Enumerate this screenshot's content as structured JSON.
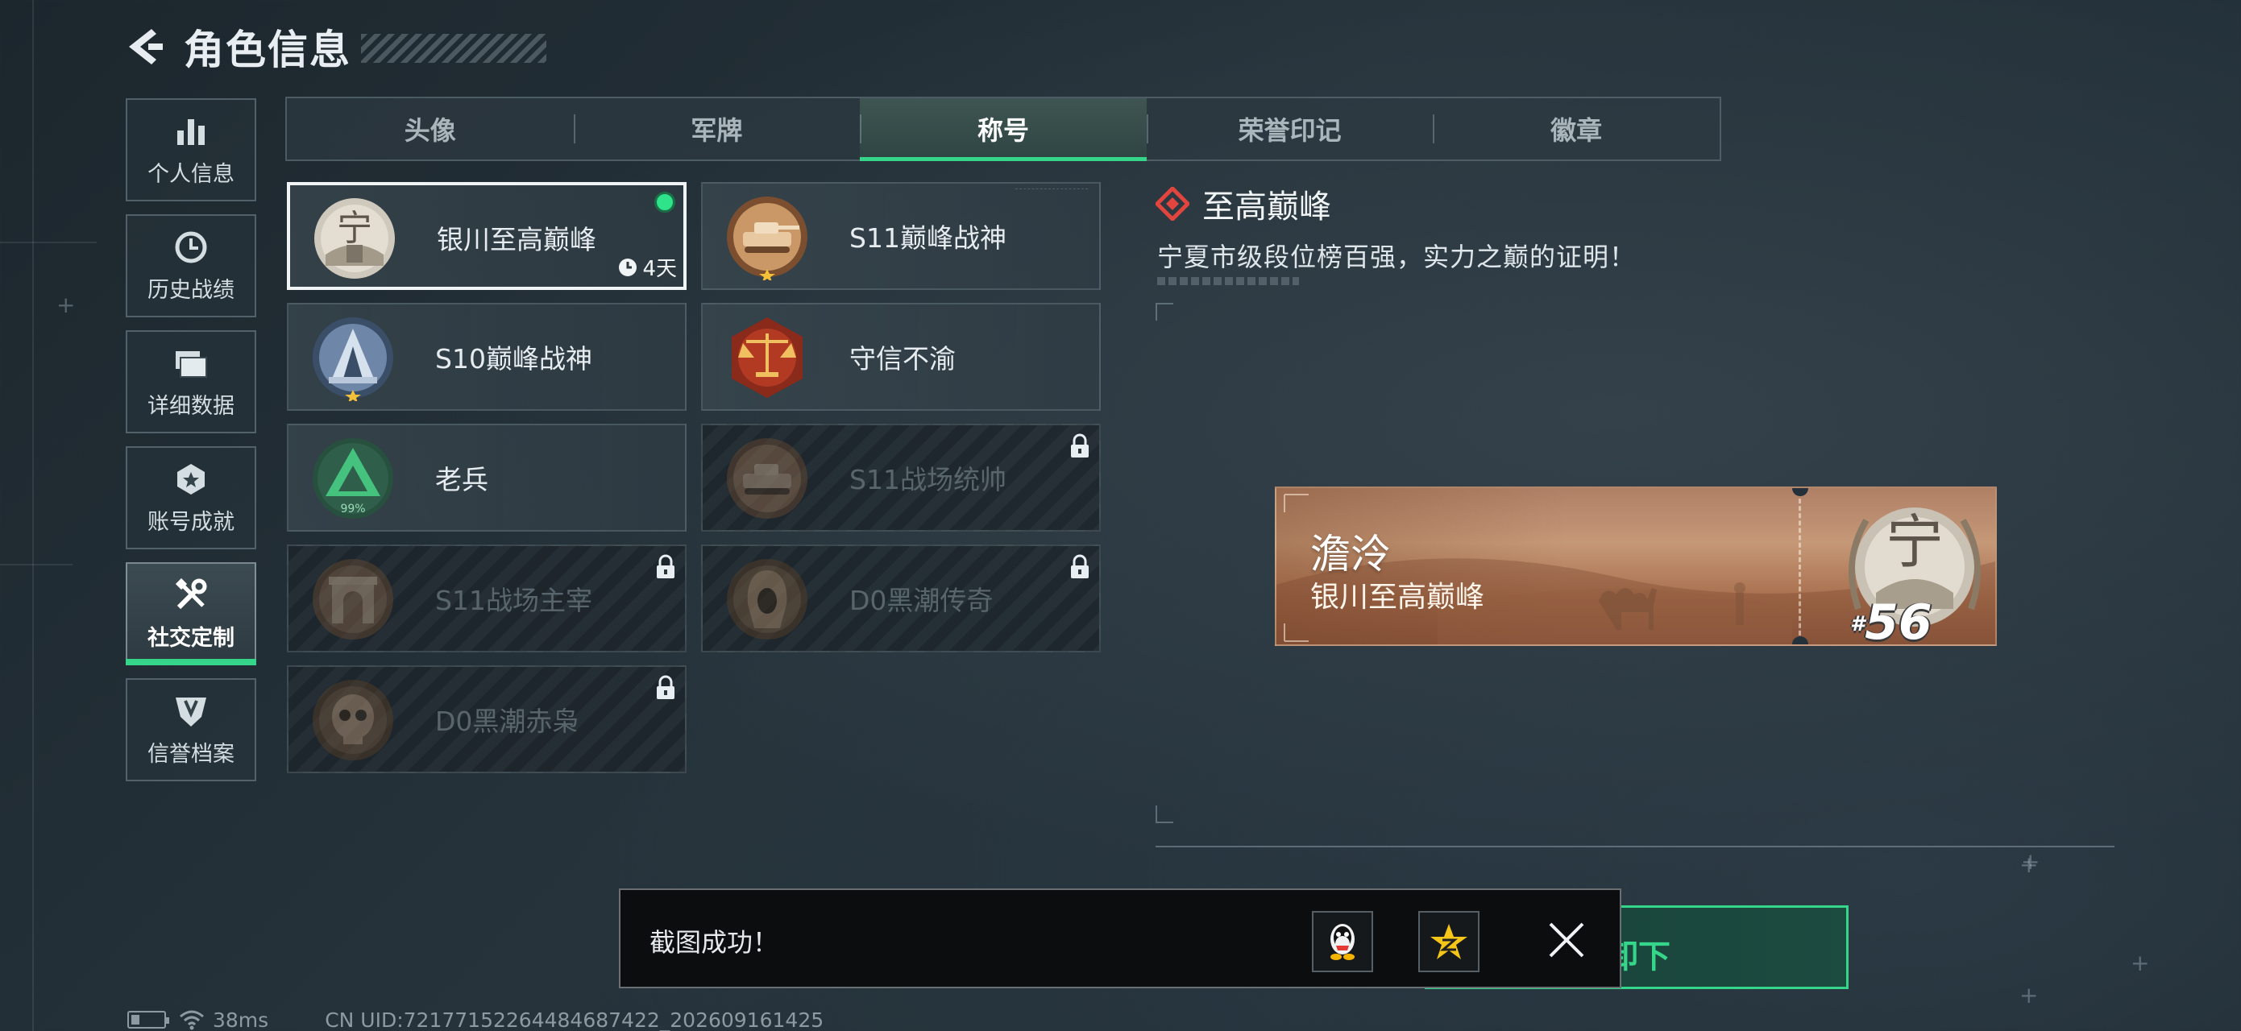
{
  "header": {
    "title": "角色信息"
  },
  "sidebar": {
    "items": [
      {
        "label": "个人信息",
        "icon": "bar-chart-icon",
        "active": false
      },
      {
        "label": "历史战绩",
        "icon": "clock-icon",
        "active": false
      },
      {
        "label": "详细数据",
        "icon": "folders-icon",
        "active": false
      },
      {
        "label": "账号成就",
        "icon": "medal-icon",
        "active": false
      },
      {
        "label": "社交定制",
        "icon": "tools-icon",
        "active": true
      },
      {
        "label": "信誉档案",
        "icon": "shield-icon",
        "active": false
      }
    ]
  },
  "tabs": [
    {
      "label": "头像",
      "active": false
    },
    {
      "label": "军牌",
      "active": false
    },
    {
      "label": "称号",
      "active": true
    },
    {
      "label": "荣誉印记",
      "active": false
    },
    {
      "label": "徽章",
      "active": false
    }
  ],
  "titles": [
    {
      "name": "银川至高巅峰",
      "badge": "ningxia-peak-badge-icon",
      "locked": false,
      "selected": true,
      "equipped": true,
      "timer": "4天"
    },
    {
      "name": "S11巅峰战神",
      "badge": "tank-laurel-badge-icon",
      "locked": false,
      "selected": false
    },
    {
      "name": "S10巅峰战神",
      "badge": "tower-laurel-badge-icon",
      "locked": false,
      "selected": false
    },
    {
      "name": "守信不渝",
      "badge": "scales-badge-icon",
      "locked": false,
      "selected": false
    },
    {
      "name": "老兵",
      "badge": "veteran-triangle-badge-icon",
      "locked": false,
      "selected": false,
      "badge_text": "99%"
    },
    {
      "name": "S11战场统帅",
      "badge": "tank-badge-icon",
      "locked": true,
      "selected": false
    },
    {
      "name": "S11战场主宰",
      "badge": "arch-badge-icon",
      "locked": true,
      "selected": false
    },
    {
      "name": "D0黑潮传奇",
      "badge": "hooded-figure-badge-icon",
      "locked": true,
      "selected": false
    },
    {
      "name": "D0黑潮赤枭",
      "badge": "skull-badge-icon",
      "locked": true,
      "selected": false
    }
  ],
  "detail": {
    "title": "至高巅峰",
    "description": "宁夏市级段位榜百强，实力之巅的证明！",
    "preview": {
      "player_name": "澹泠",
      "player_title": "银川至高巅峰",
      "rank_prefix": "#",
      "rank": "56"
    }
  },
  "action_button": {
    "label": "卸下"
  },
  "toast": {
    "message": "截图成功！",
    "share_targets": [
      "qq-penguin-icon",
      "qzone-star-icon"
    ]
  },
  "footer": {
    "ping": "38ms",
    "uid": "CN UID:7217715226448468742​2_202609161425"
  },
  "colors": {
    "accent_green": "#35d68a",
    "locked_text": "#59656c",
    "detail_diamond": "#e2443e",
    "equipped_dot": "#2fe38a"
  }
}
